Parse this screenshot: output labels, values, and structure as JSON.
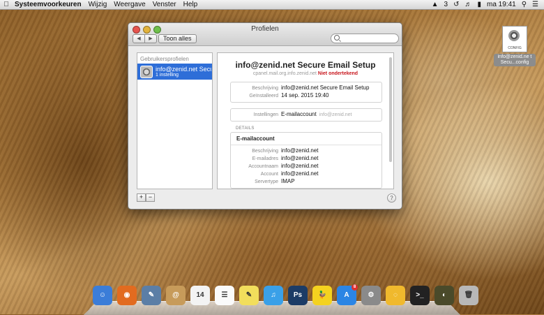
{
  "menubar": {
    "app": "Systeemvoorkeuren",
    "menus": [
      "Wijzig",
      "Weergave",
      "Venster",
      "Help"
    ],
    "badge_count": "3",
    "clock": "ma 19:41"
  },
  "window": {
    "title": "Profielen",
    "back_label": "◀",
    "forward_label": "▶",
    "show_all": "Toon alles",
    "search_placeholder": ""
  },
  "sidebar": {
    "heading": "Gebruikersprofielen",
    "items": [
      {
        "name": "info@zenid.net Secure...",
        "sub": "1 instelling"
      }
    ]
  },
  "profile": {
    "title": "info@zenid.net Secure Email Setup",
    "origin": "cpanel.mail.org.info.zenid.net",
    "signed_status": "Niet ondertekend",
    "description_label": "Beschrijving",
    "description": "info@zenid.net Secure Email Setup",
    "installed_label": "Geïnstalleerd",
    "installed": "14 sep. 2015 19:40",
    "settings_label": "Instellingen",
    "settings_value": "E-mailaccount",
    "settings_extra": "info@zenid.net",
    "details_heading": "DETAILS",
    "account_title": "E-mailaccount",
    "rows": [
      {
        "label": "Beschrijving",
        "value": "info@zenid.net"
      },
      {
        "label": "E-mailadres",
        "value": "info@zenid.net"
      },
      {
        "label": "Accountnaam",
        "value": "info@zenid.net"
      },
      {
        "label": "Account",
        "value": "info@zenid.net"
      },
      {
        "label": "Servertype",
        "value": "IMAP"
      }
    ]
  },
  "footer": {
    "add": "+",
    "remove": "−",
    "help": "?"
  },
  "desktop_file": {
    "icon_label": "CONFIG",
    "name": "info@zenid.ne t Secu...config"
  },
  "dock": [
    {
      "name": "finder-icon",
      "color": "#3b7dd8",
      "glyph": "☺"
    },
    {
      "name": "firefox-icon",
      "color": "#e26b1f",
      "glyph": "◉"
    },
    {
      "name": "preview-icon",
      "color": "#5b7ea6",
      "glyph": "✎"
    },
    {
      "name": "contacts-icon",
      "color": "#c79b5a",
      "glyph": "@"
    },
    {
      "name": "calendar-icon",
      "color": "#f3f3f3",
      "glyph": "14"
    },
    {
      "name": "reminders-icon",
      "color": "#fafafa",
      "glyph": "☰"
    },
    {
      "name": "stickies-icon",
      "color": "#f2de5c",
      "glyph": "✎"
    },
    {
      "name": "itunes-icon",
      "color": "#3aa0e8",
      "glyph": "♫"
    },
    {
      "name": "photoshop-icon",
      "color": "#1c3c66",
      "glyph": "Ps"
    },
    {
      "name": "cyberduck-icon",
      "color": "#f4d21f",
      "glyph": "🦆"
    },
    {
      "name": "app-store-icon",
      "color": "#2b85e4",
      "glyph": "A",
      "badge": "8"
    },
    {
      "name": "system-preferences-icon",
      "color": "#8a8a8a",
      "glyph": "⚙"
    },
    {
      "name": "adium-icon",
      "color": "#f0b92d",
      "glyph": "◌"
    },
    {
      "name": "terminal-icon",
      "color": "#222222",
      "glyph": ">_"
    },
    {
      "name": "disk-utility-icon",
      "color": "#4a4a2a",
      "glyph": "◐"
    },
    {
      "name": "trash-icon",
      "color": "#b8b8b8",
      "glyph": "🗑"
    }
  ]
}
